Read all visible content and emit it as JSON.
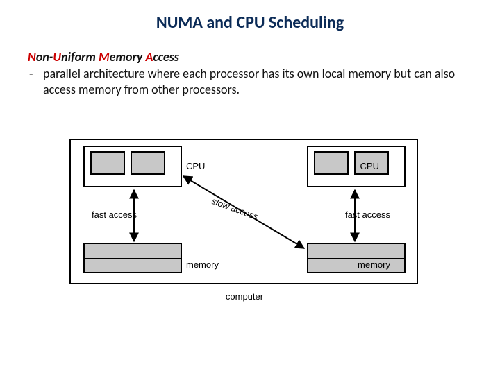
{
  "title": "NUMA and CPU Scheduling",
  "acronym": {
    "n_letter": "N",
    "n_rest": "on-",
    "u_letter": "U",
    "u_rest": "niform ",
    "m_letter": "M",
    "m_rest": "emory ",
    "a_letter": "A",
    "a_rest": "ccess"
  },
  "bullet_dash": "-",
  "bullet_text": "parallel architecture where each processor has its own local memory but can also access memory from other processors.",
  "diagram": {
    "cpu_label_left": "CPU",
    "cpu_label_right": "CPU",
    "mem_label_left": "memory",
    "mem_label_right": "memory",
    "fast_label_left": "fast access",
    "fast_label_right": "fast access",
    "slow_label": "slow access",
    "computer_label": "computer"
  }
}
